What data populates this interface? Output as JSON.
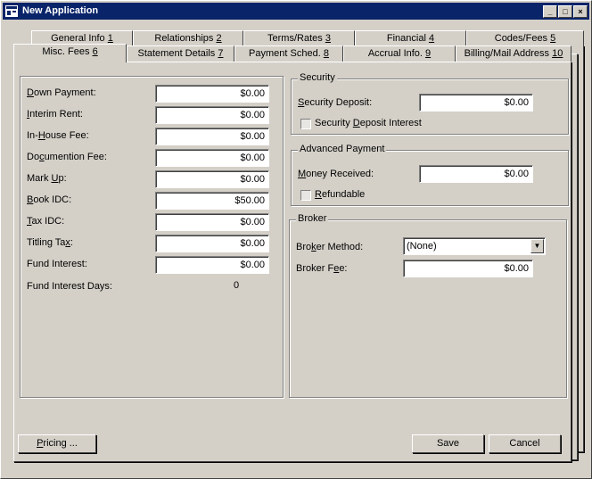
{
  "window": {
    "title": "New Application",
    "buttons": {
      "minimize": "_",
      "maximize": "□",
      "close": "×"
    }
  },
  "tabs_back": [
    {
      "text": "General Info",
      "num": "1"
    },
    {
      "text": "Relationships",
      "num": "2"
    },
    {
      "text": "Terms/Rates",
      "num": "3"
    },
    {
      "text": "Financial",
      "num": "4"
    },
    {
      "text": "Codes/Fees",
      "num": "5"
    }
  ],
  "tabs_front": [
    {
      "text": "Misc. Fees",
      "num": "6"
    },
    {
      "text": "Statement Details",
      "num": "7"
    },
    {
      "text": "Payment Sched.",
      "num": "8"
    },
    {
      "text": "Accrual Info.",
      "num": "9"
    },
    {
      "text": "Billing/Mail Address",
      "num": "10"
    }
  ],
  "fees": [
    {
      "pre": "",
      "ul": "D",
      "post": "own Payment:",
      "value": "$0.00"
    },
    {
      "pre": "",
      "ul": "I",
      "post": "nterim Rent:",
      "value": "$0.00"
    },
    {
      "pre": "In-",
      "ul": "H",
      "post": "ouse Fee:",
      "value": "$0.00"
    },
    {
      "pre": "Do",
      "ul": "c",
      "post": "umention Fee:",
      "value": "$0.00"
    },
    {
      "pre": "Mark ",
      "ul": "U",
      "post": "p:",
      "value": "$0.00"
    },
    {
      "pre": "",
      "ul": "B",
      "post": "ook IDC:",
      "value": "$50.00"
    },
    {
      "pre": "",
      "ul": "T",
      "post": "ax IDC:",
      "value": "$0.00"
    },
    {
      "pre": "Titling Ta",
      "ul": "x",
      "post": ":",
      "value": "$0.00"
    },
    {
      "pre": "Fund Interest:",
      "ul": "",
      "post": "",
      "value": "$0.00"
    }
  ],
  "fund_interest_days": {
    "label": "Fund Interest Days:",
    "value": "0"
  },
  "security": {
    "title": "Security",
    "deposit_label_ul": "S",
    "deposit_label_rest": "ecurity Deposit:",
    "deposit_value": "$0.00",
    "interest_pre": "Security ",
    "interest_ul": "D",
    "interest_post": "eposit Interest"
  },
  "advanced": {
    "title": "Advanced Payment",
    "money_ul": "M",
    "money_rest": "oney Received:",
    "money_value": "$0.00",
    "refundable_ul": "R",
    "refundable_rest": "efundable"
  },
  "broker": {
    "title": "Broker",
    "method_pre": "Bro",
    "method_ul": "k",
    "method_post": "er Method:",
    "method_value": "(None)",
    "fee_pre": "Broker F",
    "fee_ul": "e",
    "fee_post": "e:",
    "fee_value": "$0.00"
  },
  "buttons": {
    "pricing_ul": "P",
    "pricing_rest": "ricing ...",
    "save": "Save",
    "cancel": "Cancel"
  },
  "colors": {
    "titlebar": "#0a246a",
    "face": "#d4d0c8"
  }
}
